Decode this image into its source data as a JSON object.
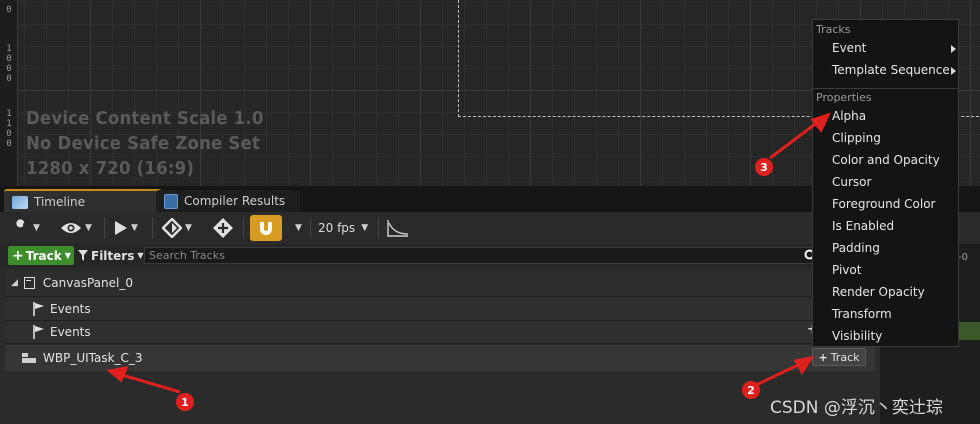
{
  "viewport": {
    "info_lines": [
      "Device Content Scale 1.0",
      "No Device Safe Zone Set",
      "1280 x 720 (16:9)"
    ],
    "ruler_digits": [
      "0",
      "1",
      "0",
      "0",
      "0",
      "1",
      "1",
      "0",
      "0"
    ]
  },
  "tabs": [
    {
      "label": "Timeline",
      "icon": "timeline-icon"
    },
    {
      "label": "Compiler Results",
      "icon": "compiler-results-icon"
    }
  ],
  "toolbar": {
    "fps_label": "20 fps",
    "icons": [
      "wrench-icon",
      "eye-icon",
      "play-icon",
      "keyframe-icon",
      "key-add-icon",
      "magnet-icon",
      "curve-icon"
    ]
  },
  "trackbar": {
    "add_track_label": "Track",
    "filters_label": "Filters",
    "search_placeholder": "Search Tracks"
  },
  "tracks": {
    "canvas_panel": "CanvasPanel_0",
    "events_1": "Events",
    "events_2": "Events",
    "widget": "WBP_UITask_C_3",
    "track_button": "Track"
  },
  "right_ruler": "-0",
  "menu": {
    "tracks_heading": "Tracks",
    "track_items": [
      "Event",
      "Template Sequence"
    ],
    "properties_heading": "Properties",
    "property_items": [
      "Alpha",
      "Clipping",
      "Color and Opacity",
      "Cursor",
      "Foreground Color",
      "Is Enabled",
      "Padding",
      "Pivot",
      "Render Opacity",
      "Transform",
      "Visibility"
    ]
  },
  "annotations": {
    "badges": [
      "1",
      "2",
      "3"
    ],
    "color": "#e0201e"
  },
  "colors": {
    "accent_tab": "#c98a1b",
    "snap_button": "#d89b23",
    "add_track": "#3d8e2a"
  },
  "watermark": "CSDN @浮沉丶奕辻琮"
}
